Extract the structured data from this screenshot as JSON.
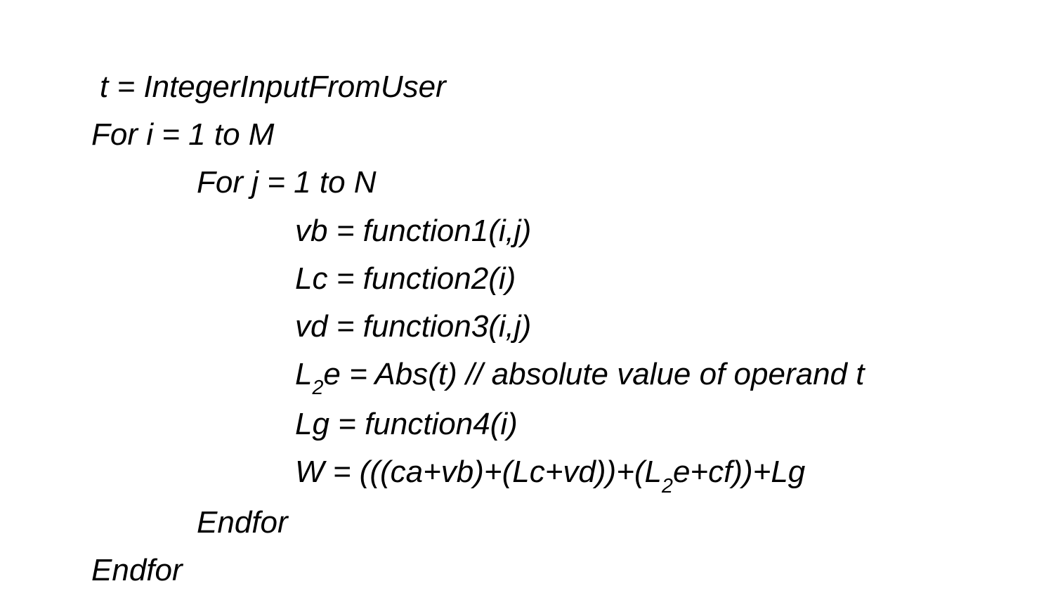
{
  "code": {
    "lines": [
      {
        "indent": "indent0b",
        "parts": [
          {
            "t": "t = IntegerInputFromUser"
          }
        ]
      },
      {
        "indent": "indent0",
        "parts": [
          {
            "t": "For i = 1 to M"
          }
        ]
      },
      {
        "indent": "indent1",
        "parts": [
          {
            "t": "For j = 1 to N"
          }
        ]
      },
      {
        "indent": "indent2",
        "parts": [
          {
            "t": "vb = function1(i,j)"
          }
        ]
      },
      {
        "indent": "indent2",
        "parts": [
          {
            "t": "Lc = function2(i)"
          }
        ]
      },
      {
        "indent": "indent2",
        "parts": [
          {
            "t": "vd = function3(i,j)"
          }
        ]
      },
      {
        "indent": "indent2",
        "parts": [
          {
            "t": "L"
          },
          {
            "t": "2",
            "sub": true
          },
          {
            "t": "e =  Abs(t)  // absolute value of operand t"
          }
        ]
      },
      {
        "indent": "indent2",
        "parts": [
          {
            "t": "Lg = function4(i)"
          }
        ]
      },
      {
        "indent": "indent2",
        "parts": [
          {
            "t": "W = (((ca+vb)+(Lc+vd))+(L"
          },
          {
            "t": "2",
            "sub": true
          },
          {
            "t": "e+cf))+Lg"
          }
        ]
      },
      {
        "indent": "indent1",
        "parts": [
          {
            "t": "Endfor"
          }
        ]
      },
      {
        "indent": "indent0",
        "parts": [
          {
            "t": "Endfor"
          }
        ]
      }
    ]
  }
}
